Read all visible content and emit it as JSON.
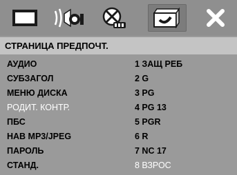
{
  "icons": [
    {
      "name": "general-setup-icon",
      "selected": false
    },
    {
      "name": "audio-setup-icon",
      "selected": false
    },
    {
      "name": "video-setup-icon",
      "selected": false
    },
    {
      "name": "preference-setup-icon",
      "selected": true
    },
    {
      "name": "exit-icon",
      "selected": false
    }
  ],
  "title": "СТРАНИЦА ПРЕДПОЧТ.",
  "items": [
    {
      "label": "АУДИО",
      "value": "1 ЗАЩ РЕБ"
    },
    {
      "label": "СУБЗАГОЛ",
      "value": "2 G"
    },
    {
      "label": "МЕНЮ ДИСКА",
      "value": "3 PG"
    },
    {
      "label": "РОДИТ. КОНТР.",
      "value": "4 PG 13"
    },
    {
      "label": "ПБС",
      "value": "5 PGR"
    },
    {
      "label": "НАВ MP3/JPEG",
      "value": "6 R"
    },
    {
      "label": "ПАРОЛЬ",
      "value": "7 NC 17"
    },
    {
      "label": "СТАНД.",
      "value": "8 ВЗРОС"
    }
  ],
  "highlight": {
    "label_row": "РОДИТ. КОНТР.",
    "value_row": "8 ВЗРОС"
  },
  "colors": {
    "panel": "#9a9a9a",
    "titlebar": "#c4c4c4",
    "text": "#000000",
    "highlight": "#ffffff"
  }
}
